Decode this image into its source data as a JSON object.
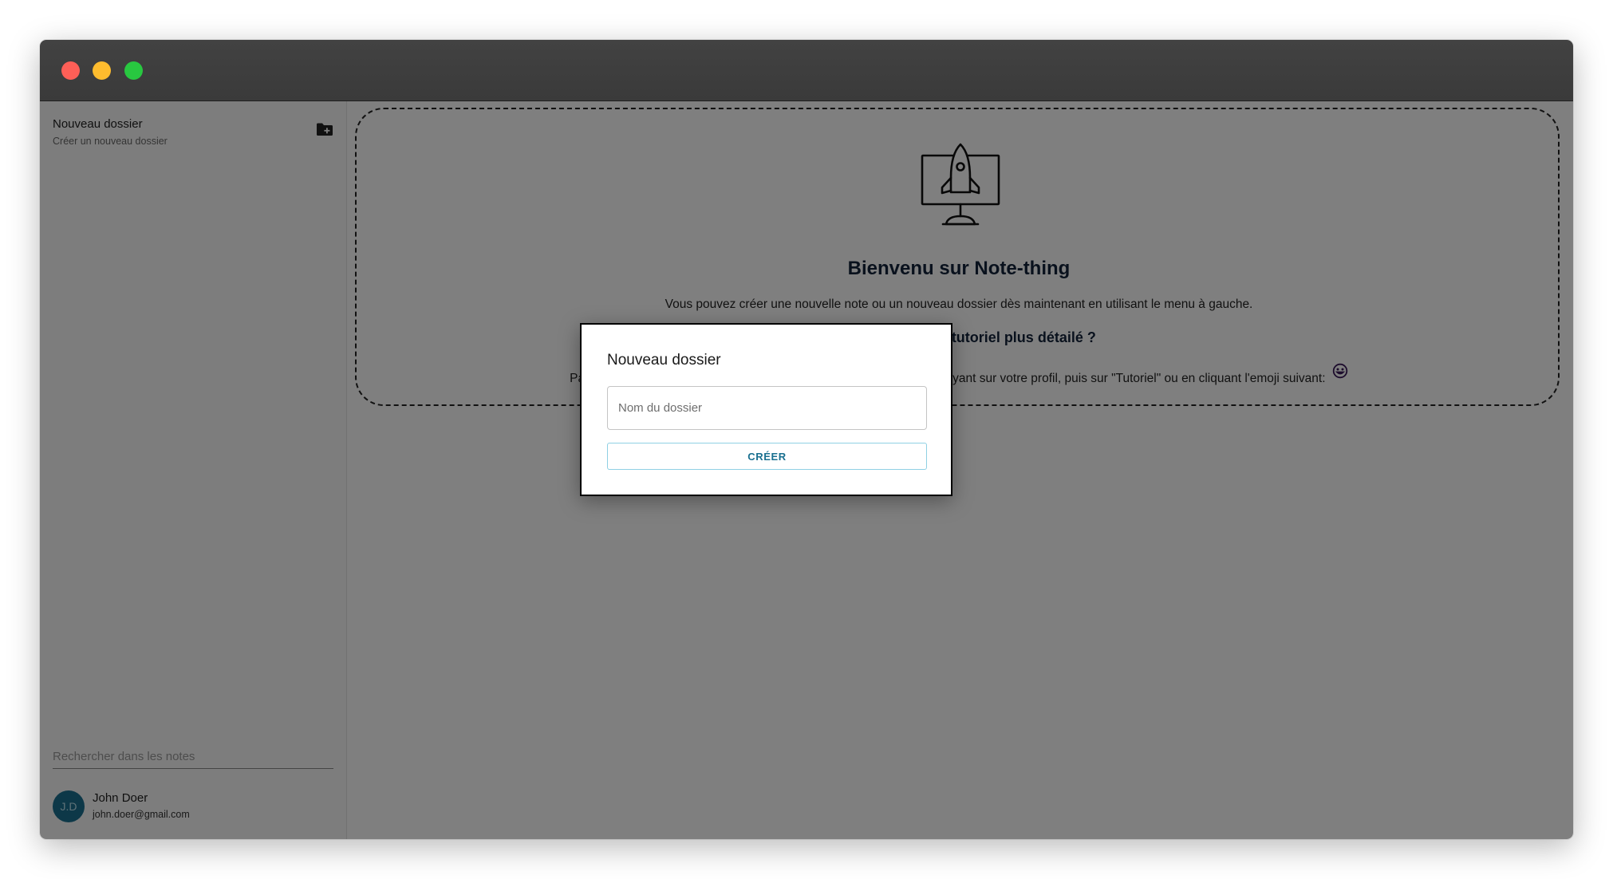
{
  "window": {
    "traffic_lights": [
      "close",
      "minimize",
      "maximize"
    ],
    "colors": {
      "close": "#fe5f57",
      "minimize": "#febc2e",
      "maximize": "#28c840"
    }
  },
  "sidebar": {
    "new_folder": {
      "title": "Nouveau dossier",
      "subtitle": "Créer un nouveau dossier",
      "icon": "folder-add-icon"
    },
    "search": {
      "placeholder": "Rechercher dans les notes",
      "value": ""
    },
    "profile": {
      "initials": "J.D",
      "name": "John Doer",
      "email": "john.doer@gmail.com",
      "avatar_color": "#1a7090"
    }
  },
  "main": {
    "illustration": "rocket-screen-icon",
    "welcome_title": "Bienvenu sur Note-thing",
    "welcome_text": "Vous pouvez créer une nouvelle note ou un nouveau dossier dès maintenant en utilisant le menu à gauche.",
    "tutorial_title": "Vous souhaitez un tutoriel plus détailé ?",
    "tutorial_text": "Pas de soucis, vous pouvez accèder à un tutoriel plus détailé en appuyant sur votre profil, puis sur \"Tutoriel\" ou en cliquant l'emoji suivant:",
    "emoji": "smiley-icon"
  },
  "dialog": {
    "title": "Nouveau dossier",
    "input": {
      "placeholder": "Nom du dossier",
      "value": ""
    },
    "button_label": "CRÉER",
    "accent_color": "#1a7090"
  }
}
